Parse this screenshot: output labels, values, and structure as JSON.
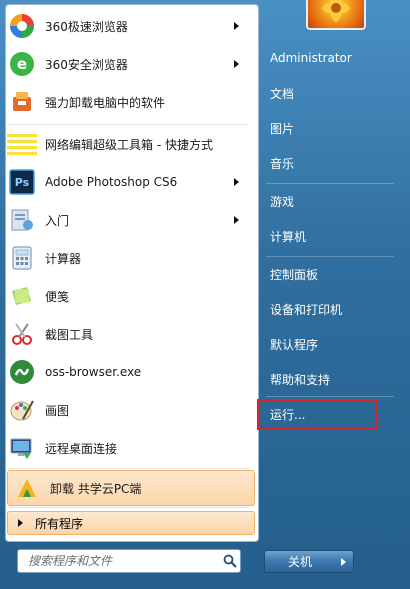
{
  "programs": [
    {
      "label": "360极速浏览器",
      "icon": "360-speed-browser-icon",
      "has_arrow": true
    },
    {
      "label": "360安全浏览器",
      "icon": "360-safe-browser-icon",
      "has_arrow": true
    },
    {
      "label": "强力卸载电脑中的软件",
      "icon": "uninstaller-icon",
      "has_arrow": false
    },
    {
      "label": "网络编辑超级工具箱 - 快捷方式",
      "icon": "text-lines-icon",
      "has_arrow": false
    },
    {
      "label": "Adobe Photoshop CS6",
      "icon": "photoshop-icon",
      "has_arrow": true
    },
    {
      "label": "入门",
      "icon": "getting-started-icon",
      "has_arrow": true
    },
    {
      "label": "计算器",
      "icon": "calculator-icon",
      "has_arrow": false
    },
    {
      "label": "便笺",
      "icon": "sticky-notes-icon",
      "has_arrow": false
    },
    {
      "label": "截图工具",
      "icon": "snipping-tool-icon",
      "has_arrow": false
    },
    {
      "label": "oss-browser.exe",
      "icon": "oss-browser-icon",
      "has_arrow": false
    },
    {
      "label": "画图",
      "icon": "paint-icon",
      "has_arrow": false
    },
    {
      "label": "远程桌面连接",
      "icon": "remote-desktop-icon",
      "has_arrow": false
    },
    {
      "label": "卸载 共学云PC端",
      "icon": "uninstall-gongxueyun-icon",
      "has_arrow": false,
      "highlighted": true
    }
  ],
  "all_programs_label": "所有程序",
  "search": {
    "placeholder": "搜索程序和文件"
  },
  "right_menu": [
    {
      "label": "Administrator"
    },
    {
      "label": "文档"
    },
    {
      "label": "图片"
    },
    {
      "label": "音乐"
    },
    {
      "label": "游戏"
    },
    {
      "label": "计算机"
    },
    {
      "label": "控制面板"
    },
    {
      "label": "设备和打印机"
    },
    {
      "label": "默认程序"
    },
    {
      "label": "帮助和支持"
    },
    {
      "label": "运行..."
    }
  ],
  "shutdown_label": "关机",
  "colors": {
    "highlight_border": "#d7262b",
    "hover_bg": "#fcd6aa"
  }
}
